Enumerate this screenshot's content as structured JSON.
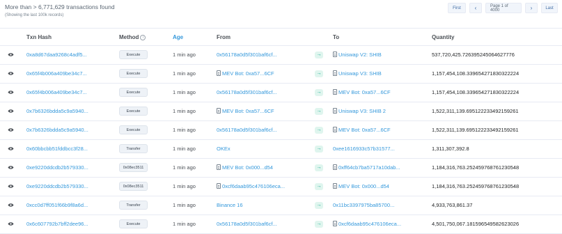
{
  "summary": {
    "text": "More than > 6,771,629 transactions found",
    "subtext": "(Showing the last 100k records)"
  },
  "pager": {
    "first": "First",
    "prev": "‹",
    "page": "Page 1 of 4000",
    "next": "›",
    "last": "Last"
  },
  "columns": {
    "txn_hash": "Txn Hash",
    "method": "Method",
    "method_info": "i",
    "age": "Age",
    "from": "From",
    "to": "To",
    "quantity": "Quantity"
  },
  "icons": {
    "eye": "eye-icon",
    "arrow": "arrow-right-icon",
    "contract": "contract-document-icon"
  },
  "rows": [
    {
      "hash": "0xa8d67daa9268c4adf5...",
      "method": "Execute",
      "age": "1 min ago",
      "from": "0x56178a0d5f301baf6cf...",
      "to": "Uniswap V2: SHIB",
      "qty": "537,720,425.726395245064627776"
    },
    {
      "hash": "0x65f4b006a409be34c7...",
      "method": "Execute",
      "age": "1 min ago",
      "from": "MEV Bot: 0xa57...6CF",
      "to": "Uniswap V3: SHIB",
      "qty": "1,157,454,108.339654271830322224"
    },
    {
      "hash": "0x65f4b006a409be34c7...",
      "method": "Execute",
      "age": "1 min ago",
      "from": "0x56178a0d5f301baf6cf...",
      "to": "MEV Bot: 0xa57...6CF",
      "qty": "1,157,454,108.339654271830322224"
    },
    {
      "hash": "0x7b6326bdda5c9a5940...",
      "method": "Execute",
      "age": "1 min ago",
      "from": "MEV Bot: 0xa57...6CF",
      "to": "Uniswap V3: SHIB 2",
      "qty": "1,522,311,139.695122233492159261"
    },
    {
      "hash": "0x7b6326bdda5c9a5940...",
      "method": "Execute",
      "age": "1 min ago",
      "from": "0x56178a0d5f301baf6cf...",
      "to": "MEV Bot: 0xa57...6CF",
      "qty": "1,522,311,139.695122233492159261"
    },
    {
      "hash": "0x60bbcbb51fddbcc3f28...",
      "method": "Transfer",
      "age": "1 min ago",
      "from": "OKEx",
      "to": "0xee1616933c57b31577...",
      "qty": "1,311,307,392.8"
    },
    {
      "hash": "0xe9220ddcdb2b579330...",
      "method": "0x08ec3511",
      "age": "1 min ago",
      "from": "MEV Bot: 0x000...d54",
      "to": "0xff64cb7ba5717a10dab...",
      "qty": "1,184,316,763.252459768761230548"
    },
    {
      "hash": "0xe9220ddcdb2b579330...",
      "method": "0x08ec3511",
      "age": "1 min ago",
      "from": "0xcf6daab95c476106eca...",
      "to": "MEV Bot: 0x000...d54",
      "qty": "1,184,316,763.252459768761230548"
    },
    {
      "hash": "0xcc0d7ff051f66b9f8a6d...",
      "method": "Transfer",
      "age": "1 min ago",
      "from": "Binance 16",
      "to": "0x11bc3397975ba85700...",
      "qty": "4,933,763,861.37"
    },
    {
      "hash": "0x6c607792b7bff2dee96...",
      "method": "Execute",
      "age": "1 min ago",
      "from": "0x56178a0d5f301baf6cf...",
      "to": "0xcf6daab95c476106eca...",
      "qty": "4,501,750,067.181596549582623026"
    }
  ],
  "from_contract": [
    false,
    true,
    false,
    true,
    false,
    false,
    true,
    true,
    false,
    false
  ],
  "to_contract": [
    true,
    true,
    true,
    true,
    true,
    false,
    true,
    true,
    false,
    true
  ]
}
